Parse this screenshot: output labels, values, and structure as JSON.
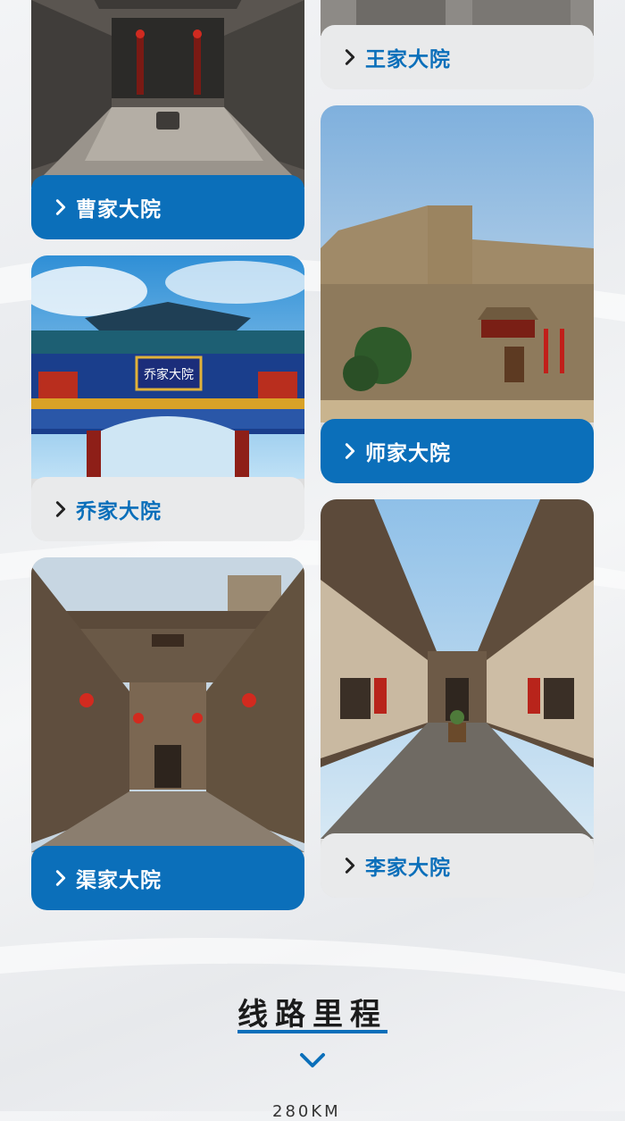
{
  "cards": [
    {
      "label": "曹家大院",
      "style": "blue"
    },
    {
      "label": "王家大院",
      "style": "light"
    },
    {
      "label": "乔家大院",
      "style": "light"
    },
    {
      "label": "师家大院",
      "style": "blue"
    },
    {
      "label": "渠家大院",
      "style": "blue"
    },
    {
      "label": "李家大院",
      "style": "light"
    }
  ],
  "archway_plaque": "乔家大院",
  "section": {
    "title": "线路里程",
    "next_text": "280KM"
  },
  "colors": {
    "accent": "#0b6fba",
    "light_caption": "#e9eaeb"
  },
  "icons": {
    "caption_arrow": "chevron-right-icon",
    "section_arrow": "chevron-down-icon"
  }
}
